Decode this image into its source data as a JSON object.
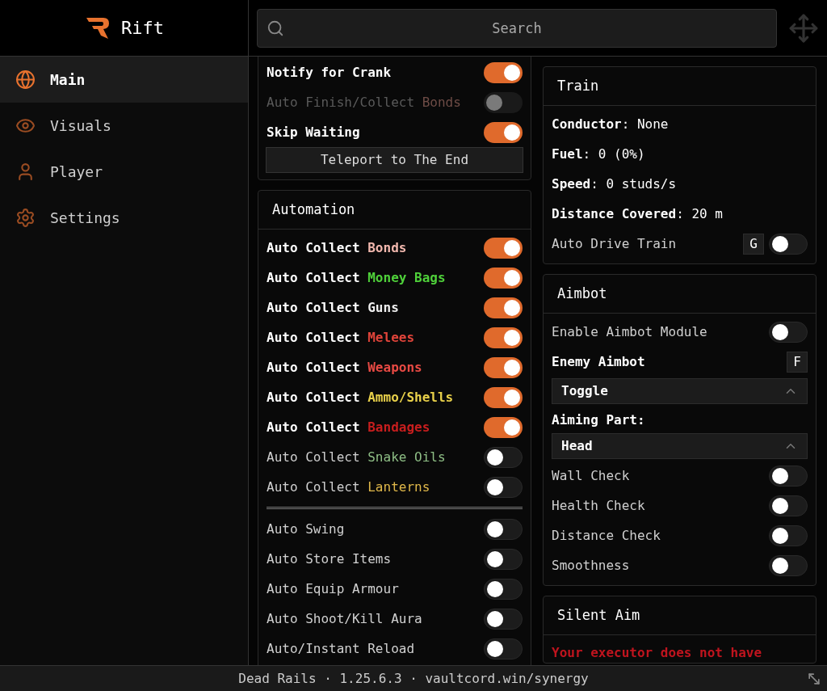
{
  "app": {
    "name": "Rift"
  },
  "search": {
    "placeholder": "Search"
  },
  "sidebar": {
    "items": [
      {
        "label": "Main",
        "kind": "globe",
        "selected": true
      },
      {
        "label": "Visuals",
        "kind": "eye",
        "selected": false
      },
      {
        "label": "Player",
        "kind": "user",
        "selected": false
      },
      {
        "label": "Settings",
        "kind": "gear",
        "selected": false
      }
    ]
  },
  "left_column": {
    "top_card": {
      "rows": [
        {
          "text": "Notify for Crank",
          "on": true,
          "disabled": false
        },
        {
          "text": "Auto Finish/Collect",
          "accent": "Bonds",
          "color": "#6e4c46",
          "on": false,
          "disabled": true
        },
        {
          "text": "Skip Waiting",
          "on": true,
          "disabled": false
        }
      ],
      "button": "Teleport to The End"
    },
    "automation": {
      "title": "Automation",
      "groups": [
        [
          {
            "text": "Auto Collect",
            "accent": "Bonds",
            "color": "#f2b8ae",
            "on": true,
            "disabled": false
          },
          {
            "text": "Auto Collect",
            "accent": "Money Bags",
            "color": "#4fd13a",
            "on": true,
            "disabled": false
          },
          {
            "text": "Auto Collect",
            "accent": "Guns",
            "color": "#eeeeee",
            "on": true,
            "disabled": false
          },
          {
            "text": "Auto Collect",
            "accent": "Melees",
            "color": "#e0443a",
            "on": true,
            "disabled": false
          },
          {
            "text": "Auto Collect",
            "accent": "Weapons",
            "color": "#e84a44",
            "on": true,
            "disabled": false
          },
          {
            "text": "Auto Collect",
            "accent": "Ammo/Shells",
            "color": "#e8d04a",
            "on": true,
            "disabled": false
          },
          {
            "text": "Auto Collect",
            "accent": "Bandages",
            "color": "#c81e1e",
            "on": true,
            "disabled": false
          },
          {
            "text": "Auto Collect",
            "accent": "Snake Oils",
            "color": "#8fbf86",
            "on": false,
            "disabled": false
          },
          {
            "text": "Auto Collect",
            "accent": "Lanterns",
            "color": "#e0b84a",
            "on": false,
            "disabled": false
          }
        ],
        [
          {
            "text": "Auto Swing",
            "on": false,
            "disabled": false
          },
          {
            "text": "Auto Store Items",
            "on": false,
            "disabled": false
          },
          {
            "text": "Auto Equip Armour",
            "on": false,
            "disabled": false
          },
          {
            "text": "Auto Shoot/Kill Aura",
            "on": false,
            "disabled": false
          },
          {
            "text": "Auto/Instant Reload",
            "on": false,
            "disabled": false
          }
        ]
      ]
    }
  },
  "right_column": {
    "train": {
      "title": "Train",
      "stats": [
        "**Conductor**: None",
        "**Fuel**: 0 (0%)",
        "**Speed**: 0 studs/s",
        "**Distance Covered**: 20 m"
      ],
      "rows": [
        {
          "kind": "toggle",
          "text": "Auto Drive Train",
          "keybind": "G",
          "on": false
        }
      ]
    },
    "aimbot": {
      "title": "Aimbot",
      "rows": [
        {
          "kind": "toggle",
          "text": "Enable Aimbot Module",
          "on": false
        },
        {
          "kind": "keybind",
          "text": "Enemy Aimbot",
          "keybind": "F"
        },
        {
          "kind": "dropdown",
          "value": "Toggle"
        },
        {
          "kind": "label",
          "text": "Aiming Part:"
        },
        {
          "kind": "dropdown",
          "value": "Head"
        },
        {
          "kind": "toggle",
          "text": "Wall Check",
          "on": false
        },
        {
          "kind": "toggle",
          "text": "Health Check",
          "on": false
        },
        {
          "kind": "toggle",
          "text": "Distance Check",
          "on": false
        },
        {
          "kind": "toggle",
          "text": "Smoothness",
          "on": false
        }
      ]
    },
    "silent_aim": {
      "title": "Silent Aim",
      "warning": "Your executor does not have"
    }
  },
  "status_bar": {
    "text": "Dead Rails · 1.25.6.3 · vaultcord.win/synergy"
  }
}
